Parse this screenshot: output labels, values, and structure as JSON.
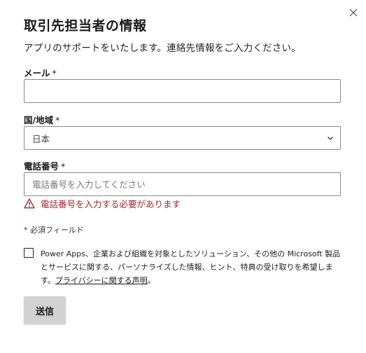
{
  "dialog": {
    "title": "取引先担当者の情報",
    "subtitle": "アプリのサポートをいたします。連絡先情報をご入力ください。",
    "close_icon": "close-icon"
  },
  "form": {
    "email": {
      "label": "メール",
      "required_mark": "*",
      "value": "",
      "placeholder": ""
    },
    "country": {
      "label": "国/地域",
      "required_mark": "*",
      "selected": "日本",
      "icon": "chevron-down-icon"
    },
    "phone": {
      "label": "電話番号",
      "required_mark": "*",
      "value": "",
      "placeholder": "電話番号を入力してください",
      "error": "電話番号を入力する必要があります",
      "error_icon": "warning-icon",
      "error_color": "#a4262c"
    },
    "required_note": "* 必須フィールド",
    "consent": {
      "checked": false,
      "text": "Power Apps、企業および組織を対象としたソリューション、その他の Microsoft 製品とサービスに関する、パーソナライズした情報、ヒント、特典の受け取りを希望します。",
      "link_text": "プライバシーに関する声明",
      "tail": "。"
    },
    "submit_label": "送信"
  }
}
